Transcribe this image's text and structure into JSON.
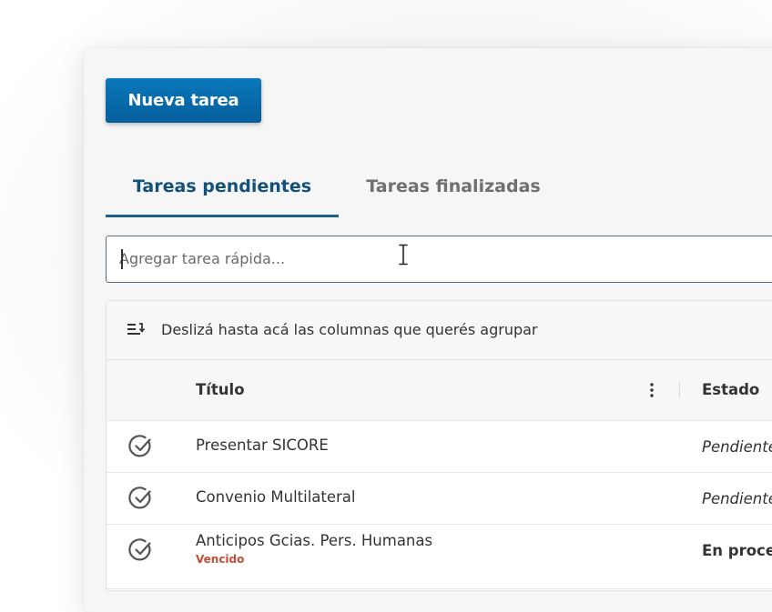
{
  "toolbar": {
    "new_task_label": "Nueva tarea"
  },
  "tabs": [
    {
      "label": "Tareas pendientes",
      "active": true
    },
    {
      "label": "Tareas finalizadas",
      "active": false
    }
  ],
  "quick_add": {
    "placeholder": "Agregar tarea rápida...",
    "value": ""
  },
  "grid": {
    "group_panel_text": "Deslizá hasta acá las columnas que querés agrupar",
    "columns": [
      {
        "label": "Título"
      },
      {
        "label": "Estado"
      }
    ],
    "rows": [
      {
        "title": "Presentar SICORE",
        "status": "Pendiente",
        "status_style": "italic",
        "badge": ""
      },
      {
        "title": "Convenio Multilateral",
        "status": "Pendiente",
        "status_style": "italic",
        "badge": ""
      },
      {
        "title": "Anticipos Gcias. Pers. Humanas",
        "status": "En proceso",
        "status_style": "bold",
        "badge": "Vencido"
      }
    ]
  },
  "colors": {
    "primary": "#0a6aab",
    "tab_active": "#14517a",
    "overdue": "#c0503b"
  },
  "icons": {
    "group": "group-by-icon",
    "check": "check-circle-icon",
    "column_menu": "vertical-dots-icon",
    "cursor": "text-cursor-icon"
  }
}
